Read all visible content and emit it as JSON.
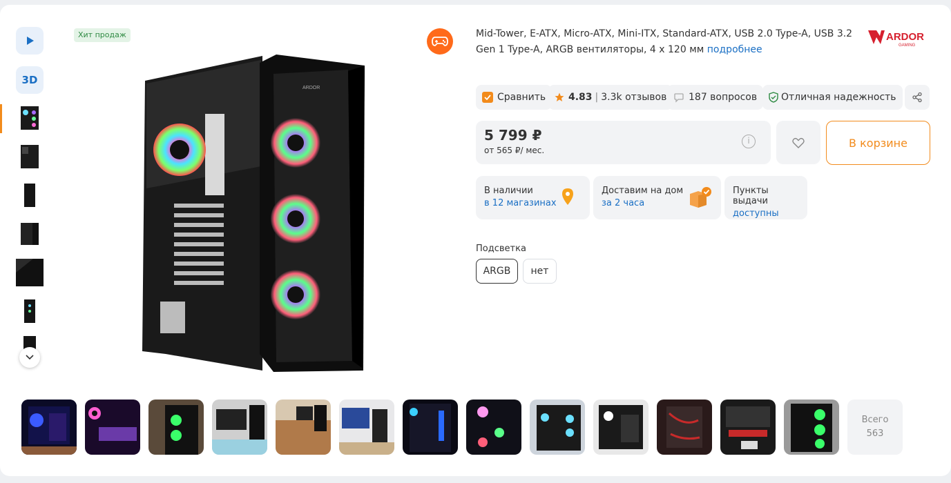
{
  "badge": "Хит продаж",
  "gallery": {
    "three_d_label": "3D",
    "strip_total_label": "Всего",
    "strip_total_count": "563"
  },
  "product": {
    "description": "Mid-Tower, E-ATX, Micro-ATX, Mini-ITX, Standard-ATX, USB 2.0 Type-A, USB 3.2 Gen 1 Type-A, ARGB вентиляторы, 4 x 120 мм",
    "more_link": "подробнее",
    "brand": "ARDOR",
    "brand_sub": "GAMING"
  },
  "meta": {
    "compare": "Сравнить",
    "rating": "4.83",
    "reviews": "3.3k отзывов",
    "questions": "187 вопросов",
    "reliability": "Отличная надежность"
  },
  "price": {
    "value": "5 799 ₽",
    "monthly": "от 565 ₽/ мес.",
    "cart": "В корзине"
  },
  "availability": [
    {
      "title": "В наличии",
      "link": "в 12 магазинах"
    },
    {
      "title": "Доставим на дом",
      "link": "за 2 часа"
    },
    {
      "title": "Пункты выдачи",
      "link": "доступны"
    }
  ],
  "options": {
    "label": "Подсветка",
    "selected": "ARGB",
    "other": "нет"
  },
  "colors": {
    "accent": "#f28b1c",
    "link": "#1a6fc4",
    "hit_bg": "#e3f3e6",
    "hit_text": "#2f8a43"
  }
}
